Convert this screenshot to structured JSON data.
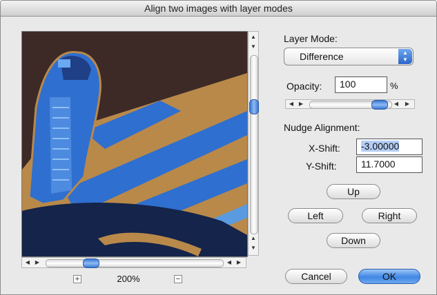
{
  "window": {
    "title": "Align two images with layer modes"
  },
  "canvas": {
    "zoom_label": "200%",
    "zoom_in_glyph": "+",
    "zoom_out_glyph": "−"
  },
  "layer_mode": {
    "label": "Layer Mode:",
    "value": "Difference"
  },
  "opacity": {
    "label": "Opacity:",
    "value": "100",
    "unit": "%",
    "level_percent": 100
  },
  "nudge": {
    "heading": "Nudge Alignment:",
    "x_label": "X-Shift:",
    "x_value": "-3.00000",
    "y_label": "Y-Shift:",
    "y_value": "11.7000"
  },
  "buttons": {
    "up": "Up",
    "left": "Left",
    "right": "Right",
    "down": "Down",
    "cancel": "Cancel",
    "ok": "OK"
  },
  "colors": {
    "accent": "#3a77d4",
    "default_button": "#3f86e4"
  }
}
